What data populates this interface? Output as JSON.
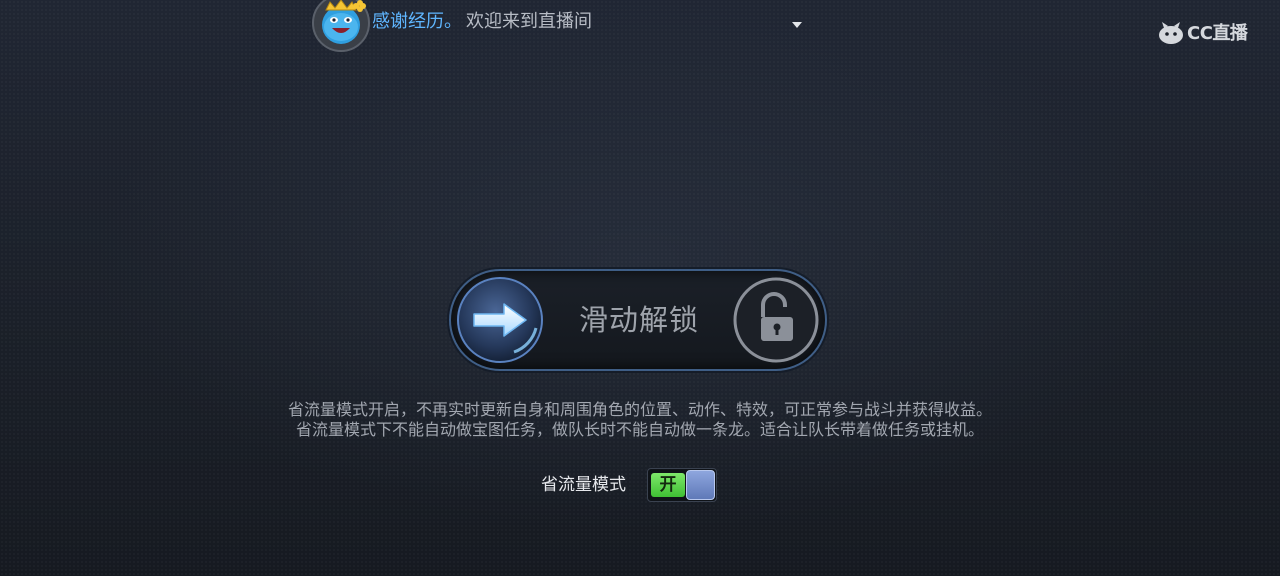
{
  "header": {
    "broadcast_user": "感谢经历。",
    "broadcast_text": "欢迎来到直播间",
    "logo_text": "CC直播"
  },
  "unlock": {
    "label": "滑动解锁"
  },
  "info": {
    "line1": "省流量模式开启，不再实时更新自身和周围角色的位置、动作、特效，可正常参与战斗并获得收益。",
    "line2": "省流量模式下不能自动做宝图任务，做队长时不能自动做一条龙。适合让队长带着做任务或挂机。"
  },
  "data_saving_mode": {
    "label": "省流量模式",
    "toggle_state_label": "开",
    "enabled": true
  },
  "colors": {
    "background": "#1b2029",
    "accent_blue": "#5fb6ff",
    "toggle_on": "#4fcf3f",
    "slider_border": "#3f5e86"
  },
  "icons": {
    "avatar": "avatar-face-icon",
    "dropdown": "dropdown-arrow-icon",
    "logo": "cc-live-logo-icon",
    "knob": "arrow-right-icon",
    "lock": "unlocked-padlock-icon"
  }
}
